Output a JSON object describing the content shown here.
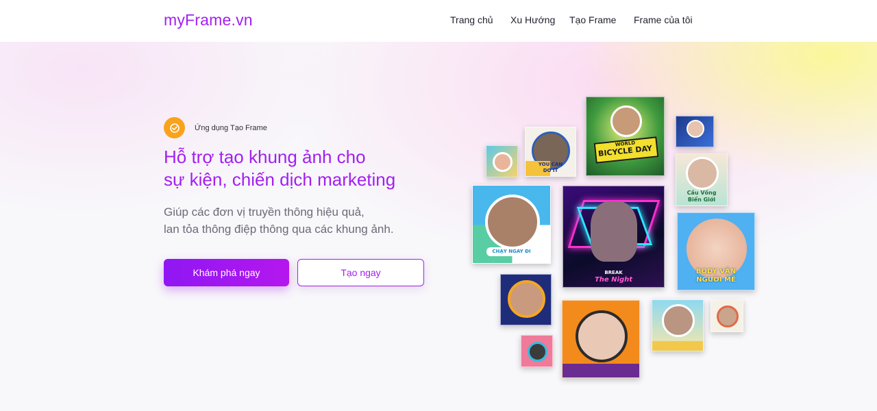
{
  "brand": {
    "logo": "myFrame.vn"
  },
  "nav": {
    "items": [
      {
        "label": "Trang chủ"
      },
      {
        "label": "Xu Hướng"
      },
      {
        "label": "Tạo Frame"
      },
      {
        "label": "Frame của tôi"
      }
    ]
  },
  "hero": {
    "badge": {
      "icon": "check-circle-icon",
      "text": "Ứng dụng Tạo Frame"
    },
    "headline": {
      "line1": "Hỗ trợ tạo khung ảnh cho",
      "line2": "sự kiện, chiến dịch marketing"
    },
    "subtext": {
      "line1": "Giúp các đơn vị truyền thông hiệu quả,",
      "line2": "lan tỏa thông điệp thông qua các khung ảnh."
    },
    "primary_button": "Khám phá ngay",
    "secondary_button": "Tạo ngay"
  },
  "gallery": {
    "bicycle": {
      "line1": "WORLD",
      "line2": "BICYCLE DAY"
    },
    "cau_vong": {
      "line1": "Cầu Vồng",
      "line2": "Biển Giới"
    },
    "body_van": {
      "line1": "BODY VẬN",
      "line2": "NGƯỜI MÊ"
    },
    "neon": {
      "line1": "BREAK",
      "line2": "The Night"
    },
    "runner": {
      "line1": "CHẠY NGAY ĐI"
    },
    "you_can": {
      "line1": "YOU CAN",
      "line2": "DO IT"
    }
  },
  "colors": {
    "brand": "#a21ff0",
    "badge": "#f9a21b",
    "text_dark": "#1f1f2e",
    "text_muted": "#6b6b78"
  }
}
